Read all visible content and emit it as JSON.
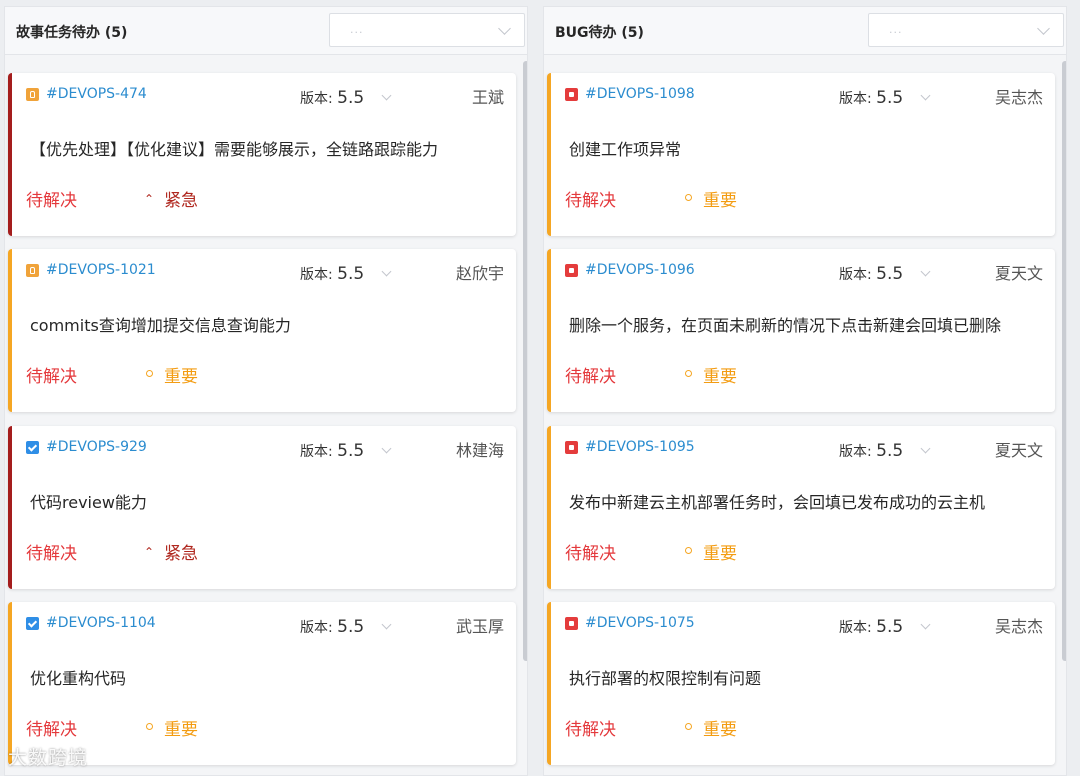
{
  "columns": [
    {
      "title": "故事任务待办 (5)",
      "filter_placeholder": "...",
      "cards": [
        {
          "type": "story",
          "id": "#DEVOPS-474",
          "version_label": "版本:",
          "version": "5.5",
          "assignee": "王斌",
          "title": "【优先处理】【优化建议】需要能够展示，全链路跟踪能力",
          "status": "待解决",
          "priority": "紧急",
          "priority_level": "urgent"
        },
        {
          "type": "story",
          "id": "#DEVOPS-1021",
          "version_label": "版本:",
          "version": "5.5",
          "assignee": "赵欣宇",
          "title": "commits查询增加提交信息查询能力",
          "status": "待解决",
          "priority": "重要",
          "priority_level": "important"
        },
        {
          "type": "task",
          "id": "#DEVOPS-929",
          "version_label": "版本:",
          "version": "5.5",
          "assignee": "林建海",
          "title": "代码review能力",
          "status": "待解决",
          "priority": "紧急",
          "priority_level": "urgent"
        },
        {
          "type": "task",
          "id": "#DEVOPS-1104",
          "version_label": "版本:",
          "version": "5.5",
          "assignee": "武玉厚",
          "title": "优化重构代码",
          "status": "待解决",
          "priority": "重要",
          "priority_level": "important"
        }
      ]
    },
    {
      "title": "BUG待办 (5)",
      "filter_placeholder": "...",
      "cards": [
        {
          "type": "bug",
          "id": "#DEVOPS-1098",
          "version_label": "版本:",
          "version": "5.5",
          "assignee": "吴志杰",
          "title": "创建工作项异常",
          "status": "待解决",
          "priority": "重要",
          "priority_level": "important"
        },
        {
          "type": "bug",
          "id": "#DEVOPS-1096",
          "version_label": "版本:",
          "version": "5.5",
          "assignee": "夏天文",
          "title": "删除一个服务，在页面未刷新的情况下点击新建会回填已删除",
          "status": "待解决",
          "priority": "重要",
          "priority_level": "important"
        },
        {
          "type": "bug",
          "id": "#DEVOPS-1095",
          "version_label": "版本:",
          "version": "5.5",
          "assignee": "夏天文",
          "title": "发布中新建云主机部署任务时，会回填已发布成功的云主机",
          "status": "待解决",
          "priority": "重要",
          "priority_level": "important"
        },
        {
          "type": "bug",
          "id": "#DEVOPS-1075",
          "version_label": "版本:",
          "version": "5.5",
          "assignee": "吴志杰",
          "title": "执行部署的权限控制有问题",
          "status": "待解决",
          "priority": "重要",
          "priority_level": "important"
        }
      ]
    }
  ],
  "watermark": "大数跨境",
  "colors": {
    "urgent_border": "#a41d1d",
    "important_border": "#f5a623",
    "status_red": "#e4393c",
    "link_blue": "#2b8ccf"
  },
  "icons": {
    "story": "lightbulb-icon",
    "task": "checkbox-icon",
    "bug": "bug-icon",
    "urgent": "double-chevron-up-icon",
    "important": "circle-icon"
  }
}
